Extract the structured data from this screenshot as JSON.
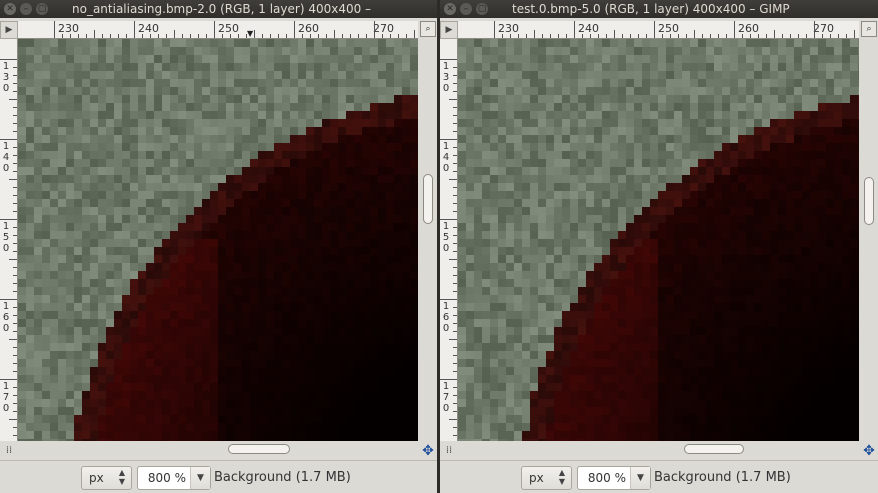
{
  "windows": [
    {
      "title": "no_antialiasing.bmp-2.0 (RGB, 1 layer) 400x400 –",
      "ruler_x": [
        "230",
        "240",
        "250",
        "260",
        "270"
      ],
      "ruler_y": [
        [
          "1",
          "3",
          "0"
        ],
        [
          "1",
          "4",
          "0"
        ],
        [
          "1",
          "5",
          "0"
        ],
        [
          "1",
          "6",
          "0"
        ],
        [
          "1",
          "7",
          "0"
        ]
      ],
      "statusbar": {
        "unit": "px",
        "zoom": "800 %",
        "text": "Background (1.7 MB)"
      }
    },
    {
      "title": "test.0.bmp-5.0 (RGB, 1 layer) 400x400 – GIMP",
      "ruler_x": [
        "230",
        "240",
        "250",
        "260",
        "270"
      ],
      "ruler_y": [
        [
          "1",
          "3",
          "0"
        ],
        [
          "1",
          "4",
          "0"
        ],
        [
          "1",
          "5",
          "0"
        ],
        [
          "1",
          "6",
          "0"
        ],
        [
          "1",
          "7",
          "0"
        ]
      ],
      "statusbar": {
        "unit": "px",
        "zoom": "800 %",
        "text": "Background (1.7 MB)"
      }
    }
  ],
  "colors": {
    "titlebar": "#3a3935",
    "window_bg": "#dcdad5",
    "canvas_noise": "#6f7266",
    "dark_band": "#2a0808",
    "highlight": "#f7d9cf",
    "navigate_icon": "#1d4f9a"
  },
  "icons": {
    "close": "close-icon",
    "minimize": "minimize-icon",
    "maximize": "maximize-icon",
    "menu_corner": "image-menu-icon",
    "zoom": "zoom-follow-icon",
    "quickmask": "quick-mask-icon",
    "navigate": "navigate-icon"
  }
}
